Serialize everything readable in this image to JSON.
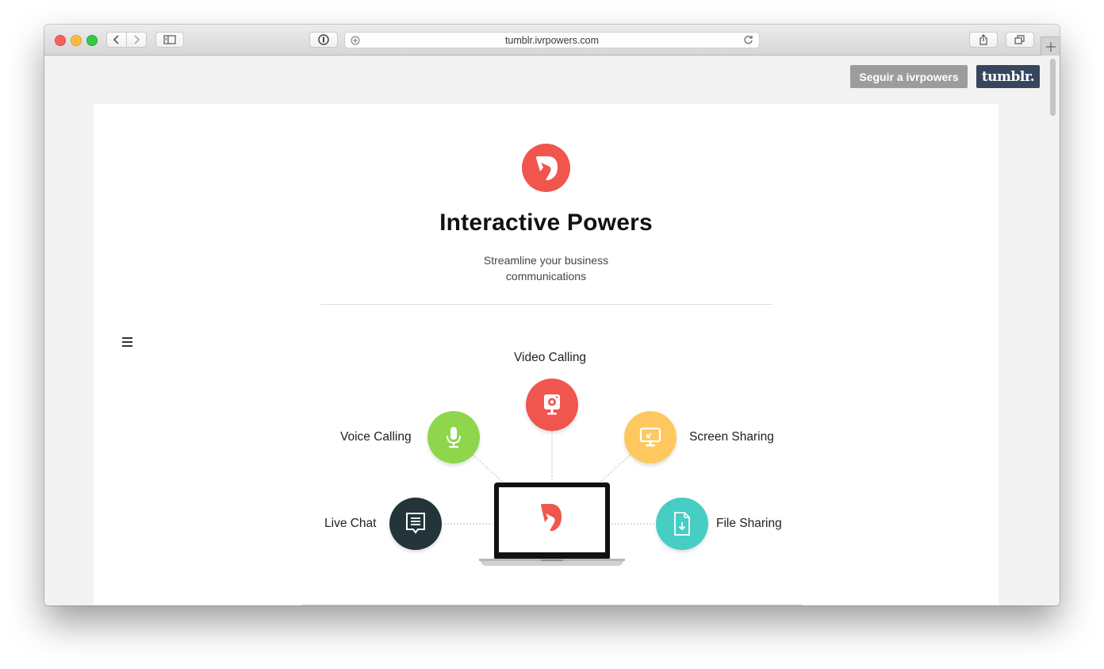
{
  "browser": {
    "url": "tumblr.ivrpowers.com",
    "buttons": {
      "back": "back-icon",
      "forward": "forward-icon",
      "sidebar": "sidebar-icon",
      "password": "password-icon",
      "reader": "add-icon",
      "reload": "reload-icon",
      "share": "share-icon",
      "tabs": "tabs-icon",
      "new_tab": "plus-icon"
    }
  },
  "tumblr_bar": {
    "follow_label": "Seguir a ivrpowers",
    "brand_label": "tumblr."
  },
  "header": {
    "title": "Interactive Powers",
    "tagline_line1": "Streamline your business",
    "tagline_line2": "communications"
  },
  "features": {
    "video": "Video Calling",
    "voice": "Voice Calling",
    "screen": "Screen Sharing",
    "chat": "Live Chat",
    "file": "File Sharing"
  },
  "colors": {
    "brand_red": "#f0554e",
    "voice_green": "#8ed64b",
    "screen_yellow": "#ffc85f",
    "chat_dark": "#23343b",
    "file_teal": "#46cdc4"
  }
}
